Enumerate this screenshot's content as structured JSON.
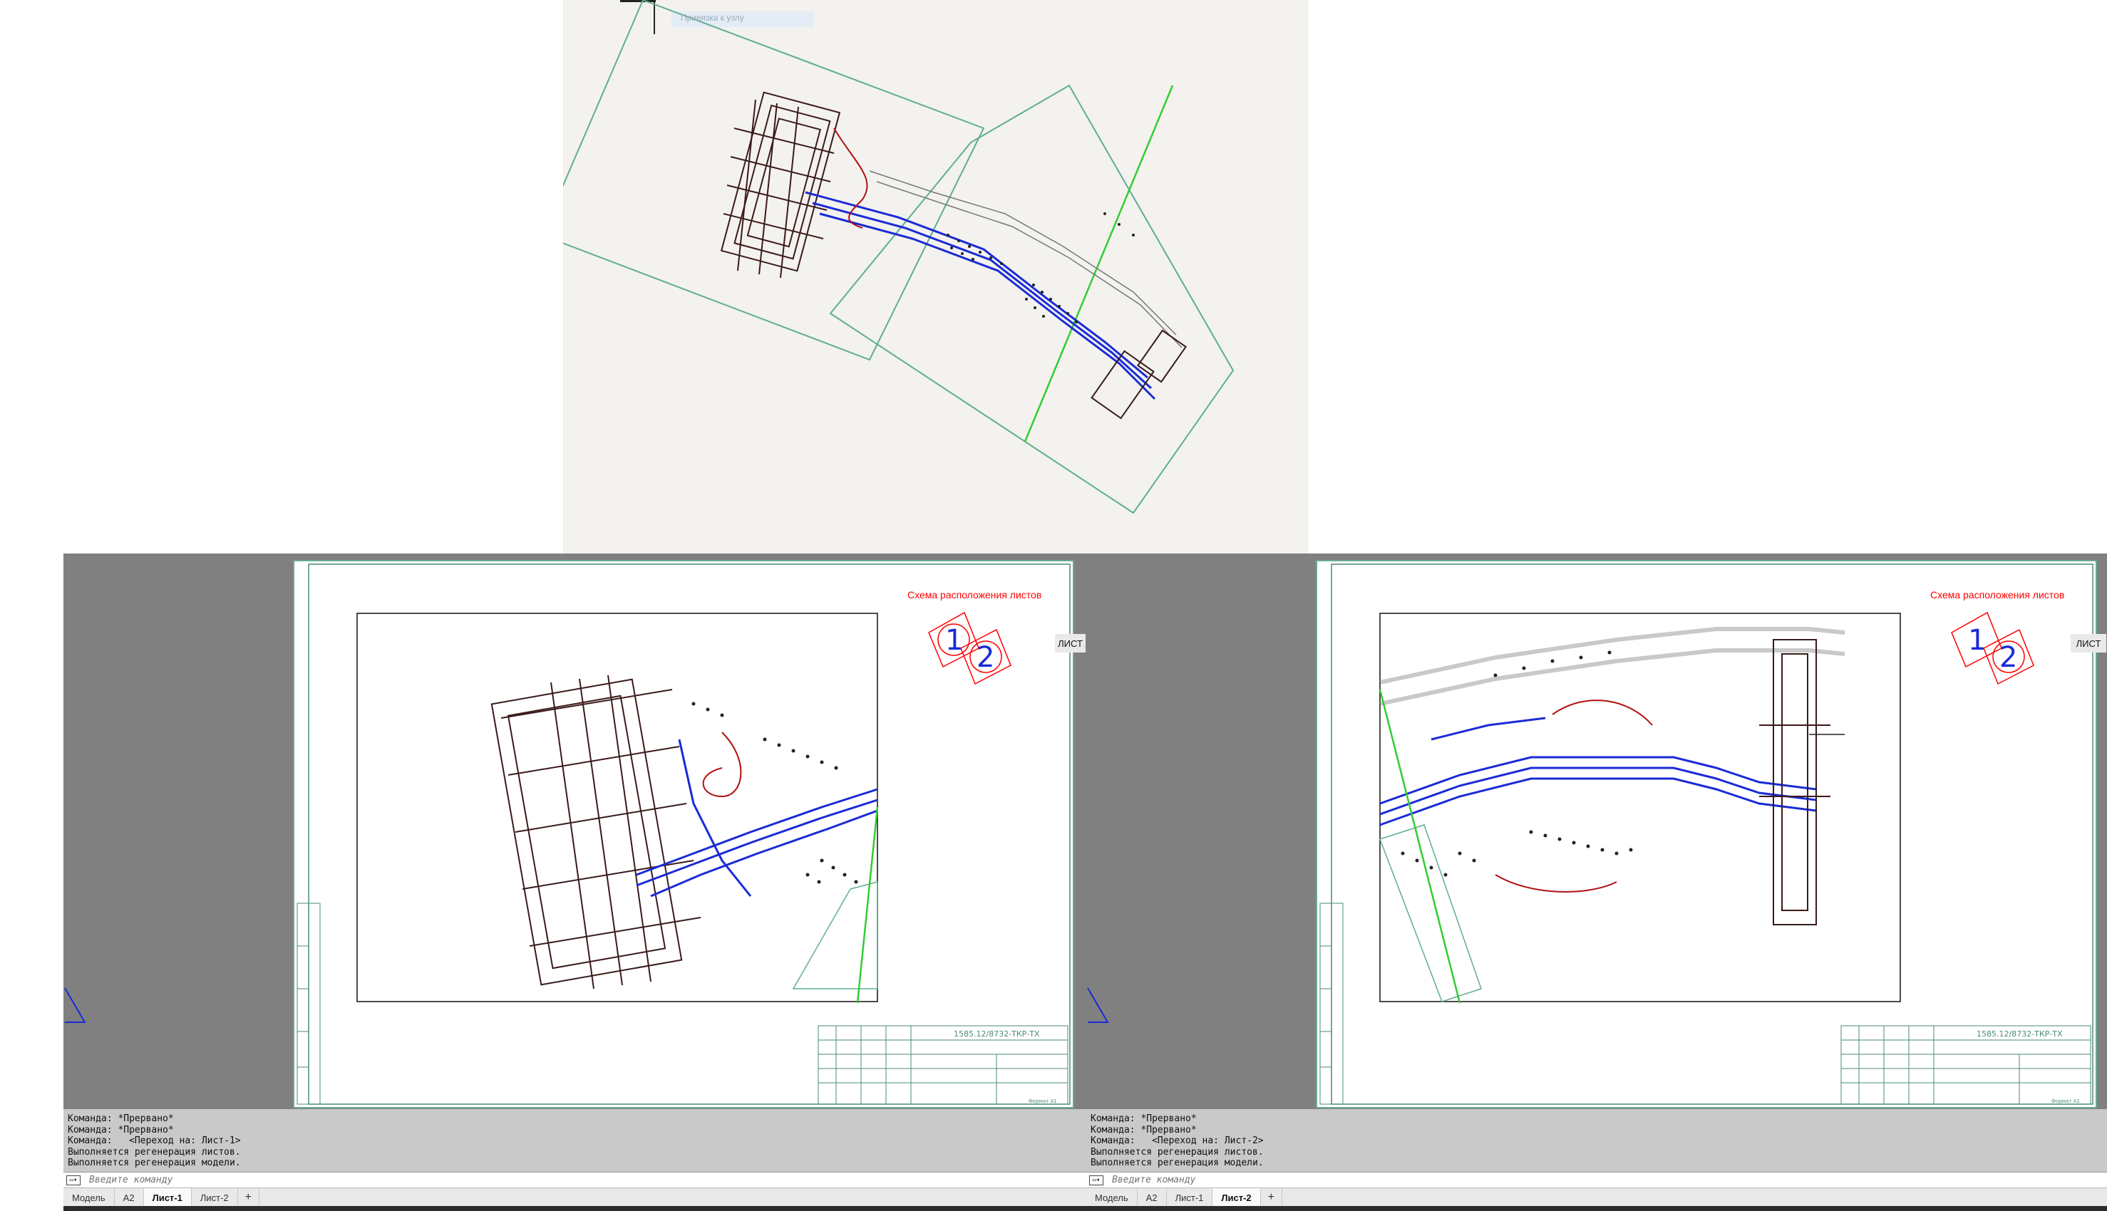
{
  "model_view": {
    "cursor_tooltip": "Привязка к узлу"
  },
  "panes": [
    {
      "id": "pane1",
      "sheet_title": "Схема расположения листов",
      "scheme_numbers": [
        "1",
        "2"
      ],
      "doc_code": "1585.12/8732-ТКР-ТХ",
      "format_label": "Формат А1",
      "command_history": [
        "Команда: *Прервано*",
        "Команда: *Прервано*",
        "Команда:   <Переход на: Лист-1>",
        "Выполняется регенерация листов.",
        "Выполняется регенерация модели."
      ],
      "command_placeholder": "Введите команду",
      "tabs": [
        "Модель",
        "A2",
        "Лист-1",
        "Лист-2",
        "+"
      ],
      "active_tab": "Лист-1",
      "status": "ЛИСТ"
    },
    {
      "id": "pane2",
      "sheet_title": "Схема расположения листов",
      "scheme_numbers": [
        "1",
        "2"
      ],
      "doc_code": "1585.12/8732-ТКР-ТХ",
      "format_label": "Формат А1",
      "command_history": [
        "Команда: *Прервано*",
        "Команда: *Прервано*",
        "Команда:   <Переход на: Лист-2>",
        "Выполняется регенерация листов.",
        "Выполняется регенерация модели."
      ],
      "command_placeholder": "Введите команду",
      "tabs": [
        "Модель",
        "A2",
        "Лист-1",
        "Лист-2",
        "+"
      ],
      "active_tab": "Лист-2",
      "status": "ЛИСТ"
    }
  ],
  "colors": {
    "model_bg": "#f3f2ee",
    "viewport_frame": "#5fae8f",
    "pipeline": "#1a2bd6",
    "section_line": "#33cc33",
    "red_text": "#ff0000",
    "paper_bg": "#808080"
  }
}
